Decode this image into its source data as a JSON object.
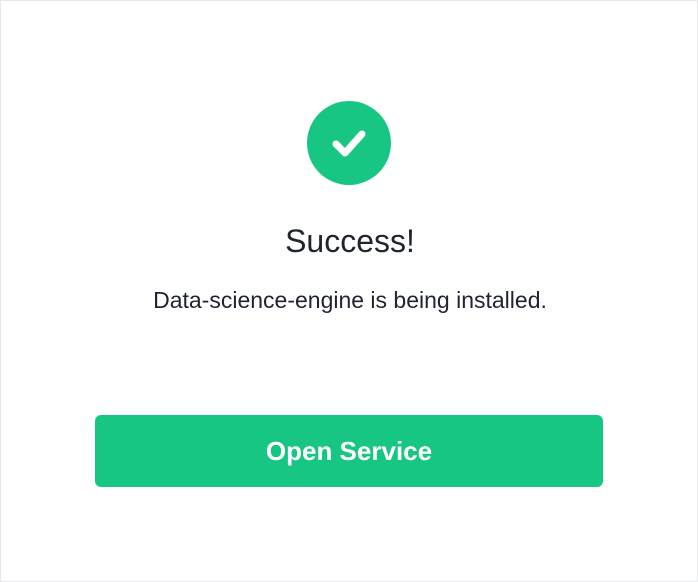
{
  "dialog": {
    "icon": "checkmark-icon",
    "title": "Success!",
    "message": "Data-science-engine is being installed.",
    "button_label": "Open Service"
  },
  "colors": {
    "accent": "#17c683",
    "text": "#1f2430",
    "background": "#ffffff"
  }
}
